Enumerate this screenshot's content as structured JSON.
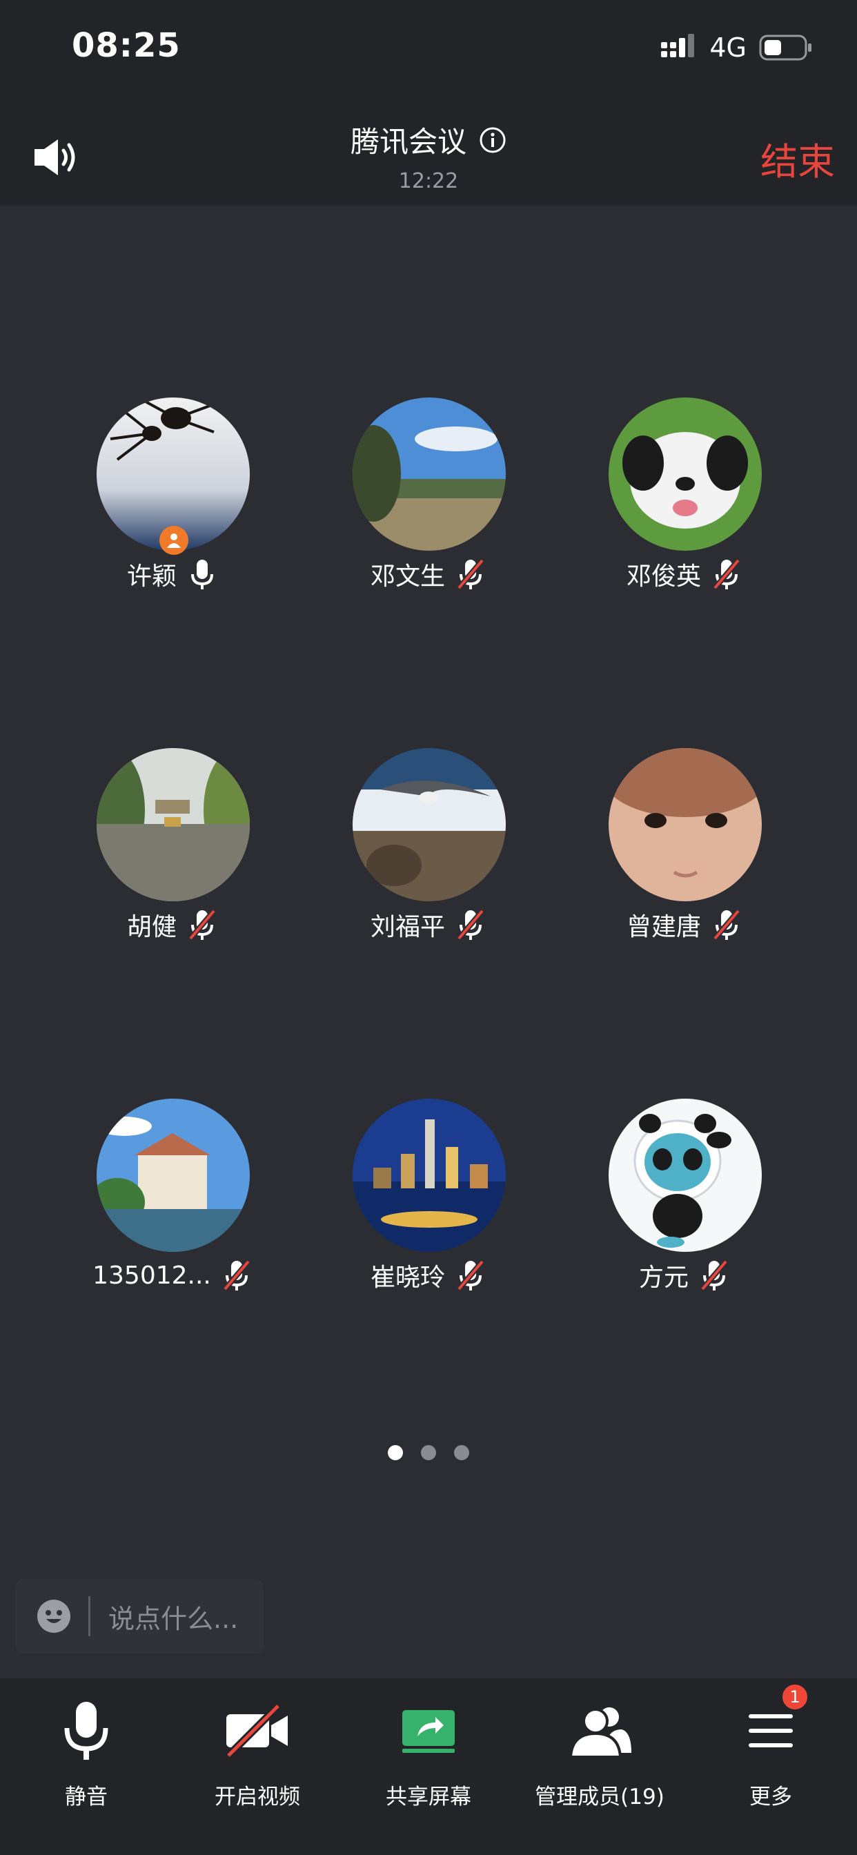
{
  "status_bar": {
    "time": "08:25",
    "network": "4G"
  },
  "header": {
    "title": "腾讯会议",
    "timer": "12:22",
    "end_label": "结束"
  },
  "participants": [
    {
      "name": "许颖",
      "mic": "on",
      "host": true
    },
    {
      "name": "邓文生",
      "mic": "muted"
    },
    {
      "name": "邓俊英",
      "mic": "muted"
    },
    {
      "name": "胡健",
      "mic": "muted"
    },
    {
      "name": "刘福平",
      "mic": "muted"
    },
    {
      "name": "曾建唐",
      "mic": "muted"
    },
    {
      "name": "135012...",
      "mic": "muted"
    },
    {
      "name": "崔晓玲",
      "mic": "muted"
    },
    {
      "name": "方元",
      "mic": "muted"
    }
  ],
  "pagination": {
    "pages": 3,
    "current": 1
  },
  "chat": {
    "placeholder": "说点什么..."
  },
  "toolbar": {
    "mute_label": "静音",
    "video_label": "开启视频",
    "share_label": "共享屏幕",
    "members_label": "管理成员(19)",
    "more_label": "更多",
    "more_badge": "1"
  },
  "colors": {
    "accent_end": "#e8453c",
    "share_green": "#37b26c",
    "badge_red": "#f04638",
    "host_badge": "#f07a2a"
  }
}
